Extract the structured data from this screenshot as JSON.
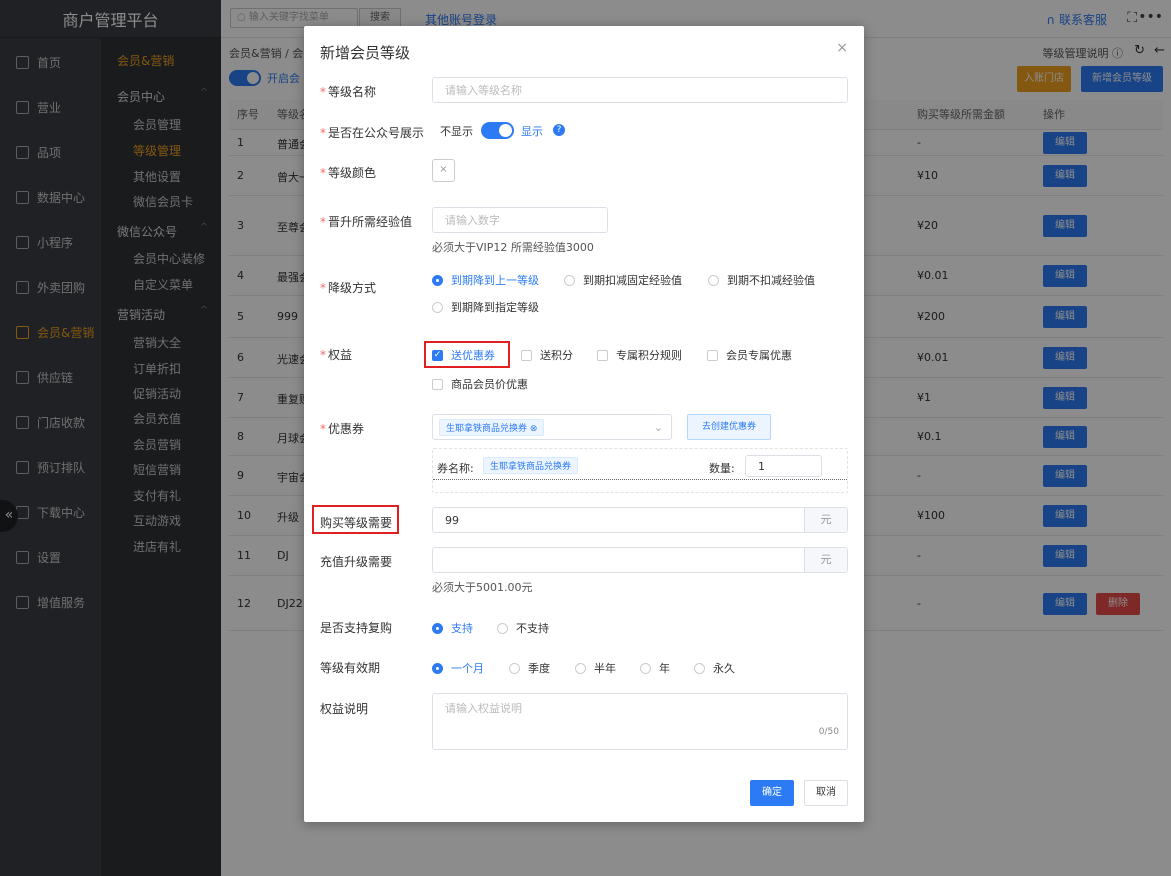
{
  "app": {
    "brand": "商户管理平台"
  },
  "nav": [
    {
      "label": "首页",
      "icon": "home-icon"
    },
    {
      "label": "营业",
      "icon": "calendar-icon"
    },
    {
      "label": "品项",
      "icon": "bag-icon"
    },
    {
      "label": "数据中心",
      "icon": "share-icon"
    },
    {
      "label": "小程序",
      "icon": "phone-icon"
    },
    {
      "label": "外卖团购",
      "icon": "group-icon"
    },
    {
      "label": "会员&营销",
      "icon": "user-icon",
      "active": true
    },
    {
      "label": "供应链",
      "icon": "truck-icon"
    },
    {
      "label": "门店收款",
      "icon": "cash-icon"
    },
    {
      "label": "预订排队",
      "icon": "clock-icon"
    },
    {
      "label": "下载中心",
      "icon": "download-icon"
    },
    {
      "label": "设置",
      "icon": "settings-icon"
    },
    {
      "label": "增值服务",
      "icon": "service-icon"
    }
  ],
  "subnav": {
    "title": "会员&营销",
    "sections": [
      {
        "label": "会员中心",
        "items": [
          "会员管理",
          "等级管理",
          "其他设置",
          "微信会员卡"
        ],
        "active": "等级管理"
      },
      {
        "label": "微信公众号",
        "items": [
          "会员中心装修",
          "自定义菜单"
        ]
      },
      {
        "label": "营销活动",
        "items": [
          "营销大全",
          "订单折扣",
          "促销活动",
          "会员充值",
          "会员营销",
          "短信营销",
          "支付有礼",
          "互动游戏",
          "进店有礼"
        ]
      }
    ]
  },
  "topbar": {
    "search_placeholder": "输入关键字找菜单",
    "search_btn": "搜索",
    "other_login": "其他账号登录",
    "contact": "联系客服"
  },
  "header": {
    "breadcrumb": "会员&营销 / 会",
    "switch_label": "开启会",
    "help": "等级管理说明 ⓘ",
    "store_btn": "入账门店",
    "new_btn": "新增会员等级"
  },
  "table": {
    "headers": [
      "序号",
      "等级名",
      "购买等级所需金额",
      "操作"
    ],
    "rows": [
      {
        "no": "1",
        "name": "普通会",
        "amount": "-"
      },
      {
        "no": "2",
        "name": "曾大一",
        "amount": "¥10"
      },
      {
        "no": "3",
        "name": "至尊会",
        "amount": "¥20"
      },
      {
        "no": "4",
        "name": "最强会",
        "amount": "¥0.01"
      },
      {
        "no": "5",
        "name": "999",
        "amount": "¥200"
      },
      {
        "no": "6",
        "name": "光速会",
        "amount": "¥0.01"
      },
      {
        "no": "7",
        "name": "重复购",
        "amount": "¥1"
      },
      {
        "no": "8",
        "name": "月球会",
        "amount": "¥0.1"
      },
      {
        "no": "9",
        "name": "宇宙会",
        "amount": "-"
      },
      {
        "no": "10",
        "name": "升级",
        "amount": "¥100"
      },
      {
        "no": "11",
        "name": "DJ",
        "amount": "-"
      },
      {
        "no": "12",
        "name": "DJ22",
        "amount": "-"
      }
    ],
    "edit": "编辑",
    "delete": "删除"
  },
  "modal": {
    "title": "新增会员等级",
    "name_label": "等级名称",
    "name_ph": "请输入等级名称",
    "show_label": "是否在公众号展示",
    "show_off": "不显示",
    "show_on": "显示",
    "color_label": "等级颜色",
    "exp_label": "晋升所需经验值",
    "exp_ph": "请输入数字",
    "exp_hint": "必须大于VIP12 所需经验值3000",
    "down_label": "降级方式",
    "down_opts": [
      "到期降到上一等级",
      "到期扣减固定经验值",
      "到期不扣减经验值",
      "到期降到指定等级"
    ],
    "rights_label": "权益",
    "rights_opts": [
      "送优惠券",
      "送积分",
      "专属积分规则",
      "会员专属优惠",
      "商品会员价优惠"
    ],
    "coupon_label": "优惠券",
    "coupon_tag": "生耶拿铁商品兑换券",
    "create_coupon": "去创建优惠券",
    "coupon_name_label": "券名称:",
    "coupon_name": "生耶拿铁商品兑换券",
    "qty_label": "数量:",
    "qty": "1",
    "buy_label": "购买等级需要",
    "buy_val": "99",
    "unit": "元",
    "recharge_label": "充值升级需要",
    "recharge_hint": "必须大于5001.00元",
    "rebuy_label": "是否支持复购",
    "rebuy_opts": [
      "支持",
      "不支持"
    ],
    "valid_label": "等级有效期",
    "valid_opts": [
      "一个月",
      "季度",
      "半年",
      "年",
      "永久"
    ],
    "desc_label": "权益说明",
    "desc_ph": "请输入权益说明",
    "desc_count": "0/50",
    "ok": "确定",
    "cancel": "取消"
  }
}
